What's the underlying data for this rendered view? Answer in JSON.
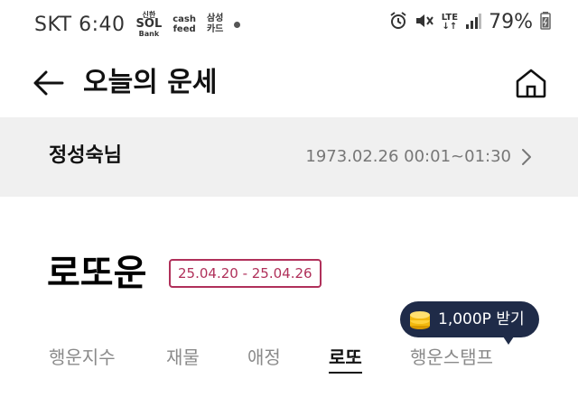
{
  "status_bar": {
    "carrier_time": "SKT 6:40",
    "app_sol_small": "신한",
    "app_sol_big": "SOL",
    "app_sol_bank": "Bank",
    "app_cash1": "cash",
    "app_cash2": "feed",
    "app_samsung1": "삼성",
    "app_samsung2": "카드",
    "network": "LTE",
    "battery": "79%"
  },
  "header": {
    "title": "오늘의 운세",
    "back_icon": "arrow-left-icon",
    "home_icon": "home-icon"
  },
  "profile": {
    "name": "정성숙님",
    "birth": "1973.02.26 00:01~01:30"
  },
  "section": {
    "title": "로또운",
    "date_range": "25.04.20 - 25.04.26"
  },
  "reward": {
    "label": "1,000P 받기",
    "icon": "coin-stack-icon"
  },
  "tabs": [
    {
      "label": "행운지수",
      "active": false
    },
    {
      "label": "재물",
      "active": false
    },
    {
      "label": "애정",
      "active": false
    },
    {
      "label": "로또",
      "active": true
    },
    {
      "label": "행운스탬프",
      "active": false
    }
  ],
  "colors": {
    "accent_badge": "#b0305a",
    "tooltip_bg": "#1f2b48",
    "profile_bg": "#f0f0f0"
  }
}
